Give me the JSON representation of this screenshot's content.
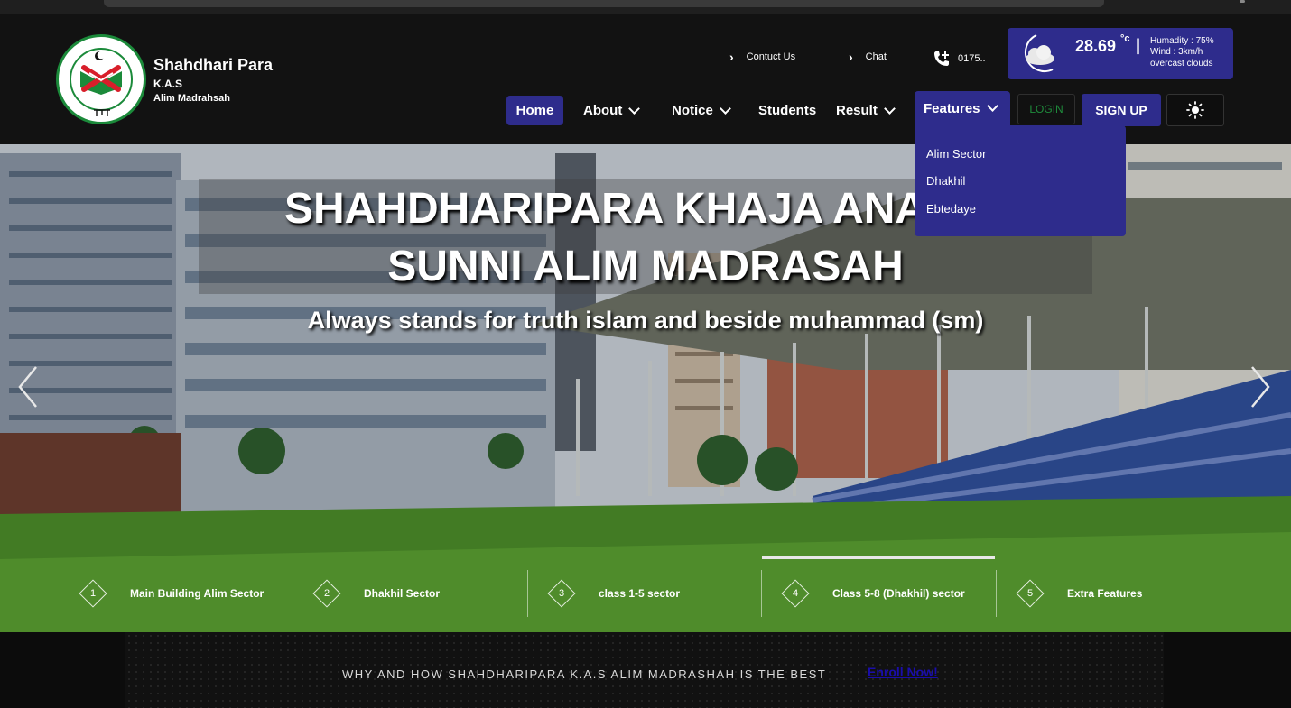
{
  "brand": {
    "title": "Shahdhari Para",
    "sub1": "K.A.S",
    "sub2": "Alim Madrahsah",
    "logo_icon": "madrasa-board-seal-icon"
  },
  "top_links": {
    "contact": "Contuct Us",
    "chat": "Chat",
    "phone": "0175.."
  },
  "weather": {
    "temp": "28.69",
    "unit": "°c",
    "humidity": "Humadity : 75%",
    "wind": "Wind : 3km/h",
    "description": "overcast clouds",
    "icon": "cloud-moon-icon"
  },
  "nav": {
    "home": "Home",
    "about": "About",
    "notice": "Notice",
    "students": "Students",
    "result": "Result",
    "features": "Features"
  },
  "features_menu": [
    "Alim Sector",
    "Dhakhil",
    "Ebtedaye"
  ],
  "auth": {
    "login": "LOGIN",
    "signup": "SIGN UP",
    "theme_icon": "sun-icon"
  },
  "hero": {
    "title_line1": "SHAHDHARIPARA KHAJA ANAYET",
    "title_line2": "SUNNI ALIM MADRASAH",
    "subtitle": "Always stands for truth islam and beside muhammad (sm)"
  },
  "slides": [
    {
      "num": "1",
      "label": "Main Building Alim Sector"
    },
    {
      "num": "2",
      "label": "Dhakhil Sector"
    },
    {
      "num": "3",
      "label": "class 1-5 sector"
    },
    {
      "num": "4",
      "label": "Class 5-8 (Dhakhil) sector"
    },
    {
      "num": "5",
      "label": "Extra Features"
    }
  ],
  "active_slide": 4,
  "banner": {
    "text": "WHY AND HOW SHAHDHARIPARA K.A.S ALIM MADRASHAH IS THE BEST",
    "enroll": "Enroll Now!"
  },
  "colors": {
    "accent": "#2e2c8c",
    "login_green": "#1f8c3c",
    "background": "#121212"
  }
}
